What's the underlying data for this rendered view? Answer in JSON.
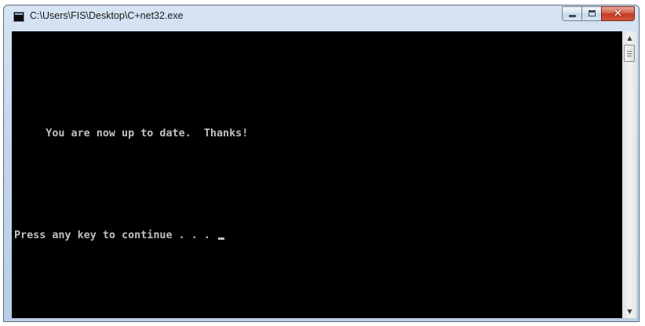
{
  "window": {
    "title": "C:\\Users\\FIS\\Desktop\\C+net32.exe",
    "controls": {
      "minimize": "minimize-icon",
      "maximize": "maximize-icon",
      "close": "close-icon"
    }
  },
  "console": {
    "lines": [
      "     You are now up to date.  Thanks!",
      "Press any key to continue . . . "
    ],
    "colors": {
      "background": "#000000",
      "text": "#c0c0c0"
    }
  },
  "scrollbar": {
    "up_arrow": "scroll-up-arrow-icon",
    "down_arrow": "scroll-down-arrow-icon"
  }
}
